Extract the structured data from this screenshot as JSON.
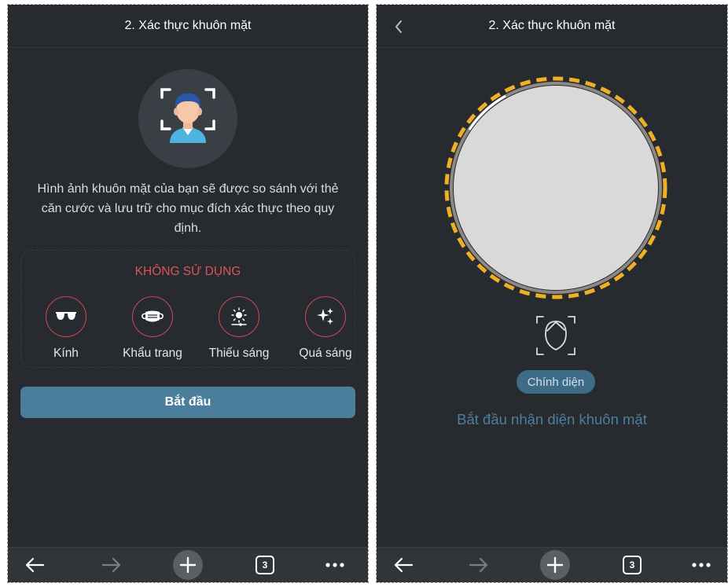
{
  "left": {
    "header_title": "2. Xác thực khuôn mặt",
    "description": "Hình ảnh khuôn mặt của bạn sẽ được so sánh với thẻ căn cước và lưu trữ cho mục đích xác thực theo quy định.",
    "restriction_title": "KHÔNG SỬ DỤNG",
    "restrictions": [
      {
        "label": "Kính",
        "icon": "glasses-icon"
      },
      {
        "label": "Khẩu trang",
        "icon": "face-mask-icon"
      },
      {
        "label": "Thiếu sáng",
        "icon": "low-light-icon"
      },
      {
        "label": "Quá sáng",
        "icon": "sparkle-icon"
      }
    ],
    "start_button": "Bắt đầu"
  },
  "right": {
    "header_title": "2. Xác thực khuôn mặt",
    "pose_label": "Chính diện",
    "status_text": "Bắt đầu nhận diện khuôn mặt"
  },
  "toolbar": {
    "tab_count": "3"
  },
  "colors": {
    "background": "#272a2f",
    "accent": "#4a7e9a",
    "warning": "#d9555a",
    "camera_ring": "#f0b024"
  }
}
